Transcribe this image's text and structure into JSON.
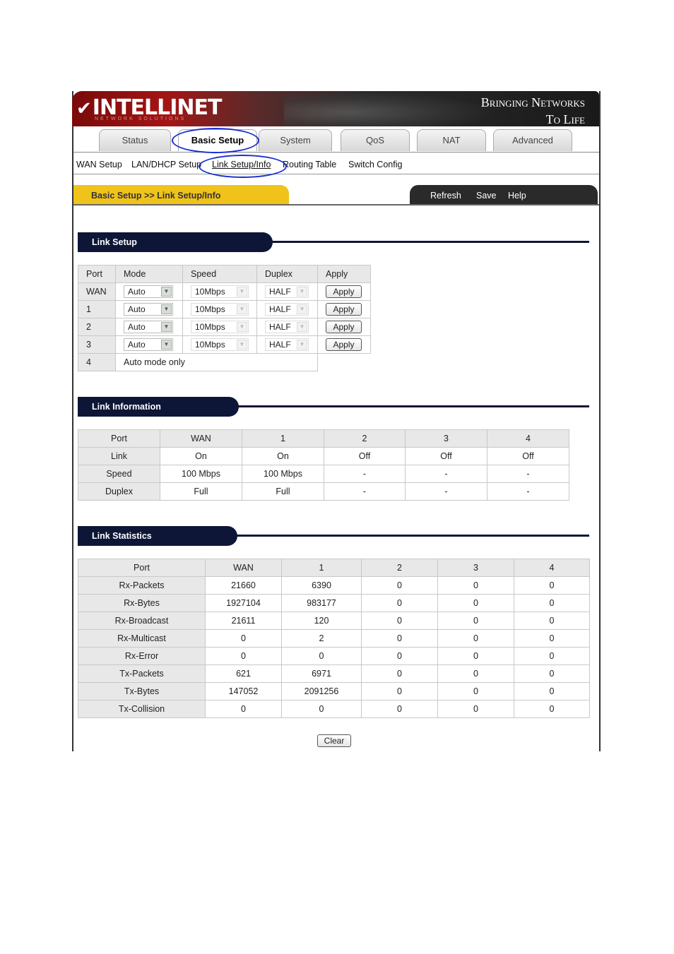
{
  "banner": {
    "logo": "INTELLINET",
    "logo_sub": "NETWORK SOLUTIONS",
    "tagline_1": "Bringing Networks",
    "tagline_2": "To Life"
  },
  "tabs": [
    {
      "label": "Status"
    },
    {
      "label": "Basic Setup",
      "active": true
    },
    {
      "label": "System"
    },
    {
      "label": "QoS"
    },
    {
      "label": "NAT"
    },
    {
      "label": "Advanced"
    }
  ],
  "subnav": [
    "WAN Setup",
    "LAN/DHCP Setup",
    "Link Setup/Info",
    "Routing Table",
    "Switch Config"
  ],
  "breadcrumb": "Basic Setup >> Link Setup/Info",
  "actions": [
    "Refresh",
    "Save",
    "Help"
  ],
  "link_setup": {
    "title": "Link Setup",
    "headers": [
      "Port",
      "Mode",
      "Speed",
      "Duplex",
      "Apply"
    ],
    "rows": [
      {
        "port": "WAN",
        "mode": "Auto",
        "speed": "10Mbps",
        "duplex": "HALF",
        "apply": "Apply"
      },
      {
        "port": "1",
        "mode": "Auto",
        "speed": "10Mbps",
        "duplex": "HALF",
        "apply": "Apply"
      },
      {
        "port": "2",
        "mode": "Auto",
        "speed": "10Mbps",
        "duplex": "HALF",
        "apply": "Apply"
      },
      {
        "port": "3",
        "mode": "Auto",
        "speed": "10Mbps",
        "duplex": "HALF",
        "apply": "Apply"
      }
    ],
    "last_port": "4",
    "last_note": "Auto mode only"
  },
  "link_info": {
    "title": "Link Information",
    "headers": [
      "Port",
      "WAN",
      "1",
      "2",
      "3",
      "4"
    ],
    "rows": [
      [
        "Link",
        "On",
        "On",
        "Off",
        "Off",
        "Off"
      ],
      [
        "Speed",
        "100 Mbps",
        "100 Mbps",
        "-",
        "-",
        "-"
      ],
      [
        "Duplex",
        "Full",
        "Full",
        "-",
        "-",
        "-"
      ]
    ]
  },
  "link_stats": {
    "title": "Link Statistics",
    "headers": [
      "Port",
      "WAN",
      "1",
      "2",
      "3",
      "4"
    ],
    "rows": [
      [
        "Rx-Packets",
        "21660",
        "6390",
        "0",
        "0",
        "0"
      ],
      [
        "Rx-Bytes",
        "1927104",
        "983177",
        "0",
        "0",
        "0"
      ],
      [
        "Rx-Broadcast",
        "21611",
        "120",
        "0",
        "0",
        "0"
      ],
      [
        "Rx-Multicast",
        "0",
        "2",
        "0",
        "0",
        "0"
      ],
      [
        "Rx-Error",
        "0",
        "0",
        "0",
        "0",
        "0"
      ],
      [
        "Tx-Packets",
        "621",
        "6971",
        "0",
        "0",
        "0"
      ],
      [
        "Tx-Bytes",
        "147052",
        "2091256",
        "0",
        "0",
        "0"
      ],
      [
        "Tx-Collision",
        "0",
        "0",
        "0",
        "0",
        "0"
      ]
    ],
    "clear_label": "Clear"
  }
}
